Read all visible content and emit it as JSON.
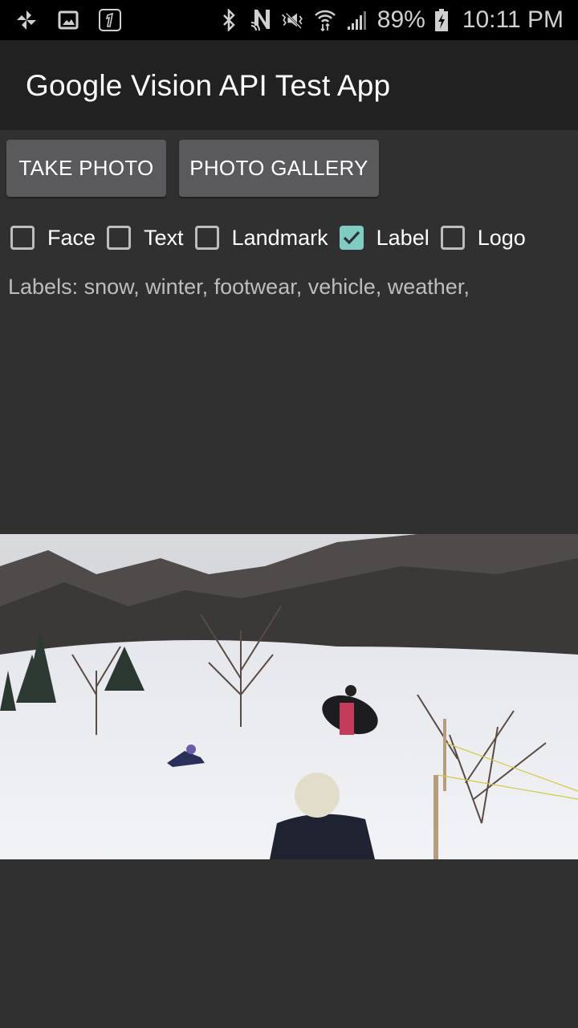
{
  "status_bar": {
    "left_icons": [
      "pinwheel-icon",
      "gallery-icon",
      "one-app-icon"
    ],
    "right_icons": [
      "bluetooth-icon",
      "nfc-icon",
      "mute-icon",
      "wifi-icon",
      "signal-icon"
    ],
    "battery_percent": "89%",
    "battery_icon": "battery-charging-icon",
    "time": "10:11 PM"
  },
  "app_bar": {
    "title": "Google Vision API Test App"
  },
  "buttons": {
    "take_photo": "TAKE PHOTO",
    "photo_gallery": "PHOTO GALLERY"
  },
  "detection_options": [
    {
      "label": "Face",
      "checked": false
    },
    {
      "label": "Text",
      "checked": false
    },
    {
      "label": "Landmark",
      "checked": false
    },
    {
      "label": "Label",
      "checked": true
    },
    {
      "label": "Logo",
      "checked": false
    }
  ],
  "result": {
    "text": "Labels:  snow, winter, footwear, vehicle, weather,"
  },
  "colors": {
    "accent": "#80cbc4",
    "background": "#303030",
    "app_bar": "#212121",
    "button": "#5a5a5c"
  },
  "photo": {
    "description": "snowy backyard with children sledding and trees"
  }
}
